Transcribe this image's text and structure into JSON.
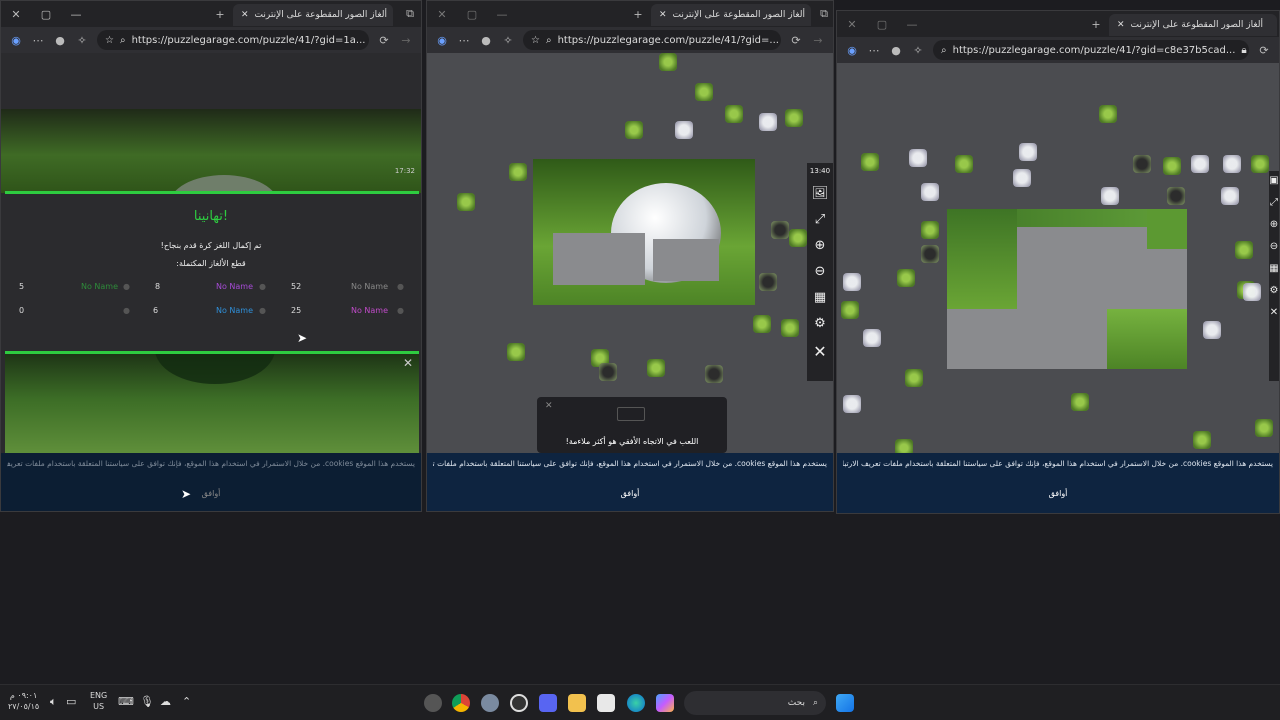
{
  "common": {
    "tab_title": "ألغاز الصور المقطوعة على الإنترنت",
    "url_short": "https://puzzlegarage.com/puzzle/41/?gid=1a...",
    "url_mid": "https://puzzlegarage.com/puzzle/41/?gid=...",
    "url_long": "https://puzzlegarage.com/puzzle/41/?gid=c8e37b5cad...",
    "cookie_text": "يستخدم هذا الموقع cookies. من خلال الاستمرار في استخدام هذا الموقع، فإنك توافق على سياستنا المتعلقة باستخدام ملفات تعريف الارتباط.",
    "cookie_word": "cookies",
    "cookie_ok": "أوافق"
  },
  "win1": {
    "time": "17:32",
    "congrats": "تهانينا!",
    "line1": "تم إكمال اللغز كرة قدم بنجاح!",
    "line2": "قطع الألغاز المكتملة:",
    "rows": [
      {
        "n1": "5",
        "name1": "No Name",
        "n2": "8",
        "name2": "No Name",
        "n3": "52",
        "name3": "No Name"
      },
      {
        "n1": "0",
        "name1": "",
        "n2": "6",
        "name2": "No Name",
        "n3": "25",
        "name3": "No Name"
      }
    ]
  },
  "win2": {
    "time": "13:40",
    "popup_text": "اللعب في الاتجاه الأفقي هو أكثر ملاءمة!"
  },
  "taskbar": {
    "time": "٠٩:٠١ م",
    "date": "٢٧/٠٥/١٥",
    "lang1": "ENG",
    "lang2": "US",
    "search": "بحث"
  },
  "colors": {
    "accent_green": "#2ecc40",
    "cookie_bg": "#0e2440",
    "purple": "#a64bd6",
    "blue": "#2f8fd8"
  }
}
